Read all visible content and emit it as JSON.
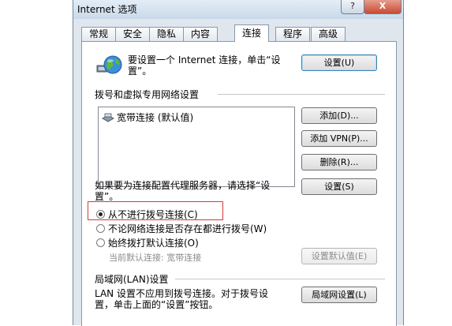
{
  "window": {
    "title": "Internet 选项",
    "help_label": "?",
    "close_label": "X"
  },
  "tabs": [
    {
      "label": "常规"
    },
    {
      "label": "安全"
    },
    {
      "label": "隐私"
    },
    {
      "label": "内容"
    },
    {
      "label": "连接"
    },
    {
      "label": "程序"
    },
    {
      "label": "高级"
    }
  ],
  "setup": {
    "text_line1": "要设置一个 Internet 连接，单击“设",
    "text_line2": "置”。",
    "button": "设置(U)"
  },
  "dialup": {
    "section_label": "拨号和虚拟专用网络设置",
    "connections": [
      {
        "label": "宽带连接 (默认值)"
      }
    ],
    "add_button": "添加(D)...",
    "add_vpn_button": "添加 VPN(P)...",
    "delete_button": "删除(R)...",
    "proxy_text_line1": "如果要为连接配置代理服务器，请选择“设",
    "proxy_text_line2": "置”。",
    "settings_button": "设置(S)",
    "radios": [
      {
        "label": "从不进行拨号连接(C)",
        "checked": true
      },
      {
        "label": "不论网络连接是否存在都进行拨号(W)",
        "checked": false
      },
      {
        "label": "始终拨打默认连接(O)",
        "checked": false
      }
    ],
    "current_default": "当前默认连接: 宽带连接",
    "set_default_button": "设置默认值(E)"
  },
  "lan": {
    "section_label": "局域网(LAN)设置",
    "text_line1": "LAN 设置不应用到拨号连接。对于拨号设",
    "text_line2": "置，单击上面的“设置”按钮。",
    "button": "局域网设置(L)"
  }
}
